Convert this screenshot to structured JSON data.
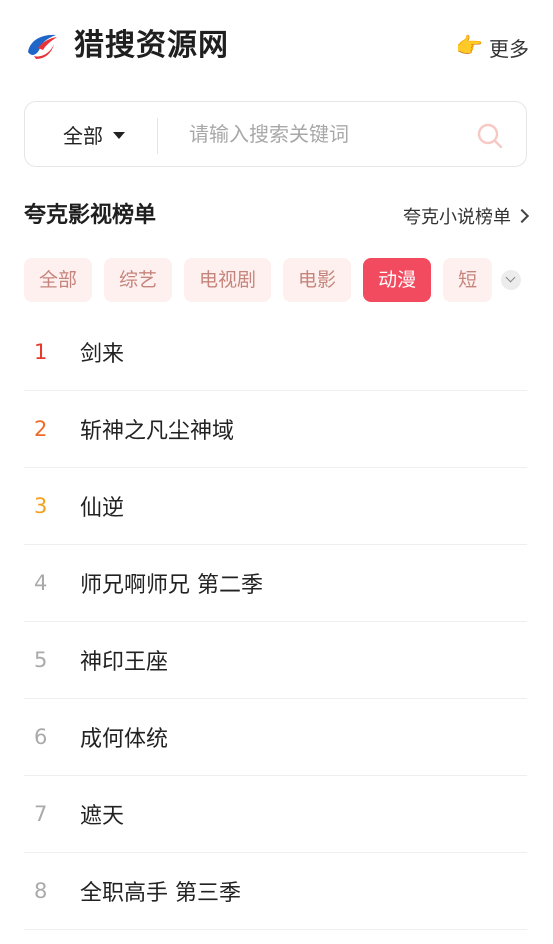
{
  "header": {
    "site_title": "猎搜资源网",
    "more_label": "更多",
    "logo_icon": "bird-logo-icon",
    "more_icon": "pointing-hand-icon"
  },
  "search": {
    "scope_label": "全部",
    "placeholder": "请输入搜索关键词",
    "value": ""
  },
  "section": {
    "title": "夸克影视榜单",
    "novel_link": "夸克小说榜单"
  },
  "tabs": [
    {
      "label": "全部",
      "active": false
    },
    {
      "label": "综艺",
      "active": false
    },
    {
      "label": "电视剧",
      "active": false
    },
    {
      "label": "电影",
      "active": false
    },
    {
      "label": "动漫",
      "active": true
    },
    {
      "label": "短",
      "active": false
    }
  ],
  "ranking": [
    {
      "rank": "1",
      "title": "剑来"
    },
    {
      "rank": "2",
      "title": "斩神之凡尘神域"
    },
    {
      "rank": "3",
      "title": "仙逆"
    },
    {
      "rank": "4",
      "title": "师兄啊师兄 第二季"
    },
    {
      "rank": "5",
      "title": "神印王座"
    },
    {
      "rank": "6",
      "title": "成何体统"
    },
    {
      "rank": "7",
      "title": "遮天"
    },
    {
      "rank": "8",
      "title": "全职高手 第三季"
    }
  ],
  "colors": {
    "accent": "#f24a5f",
    "tab_bg": "#fdf0ee",
    "tab_text": "#c6857c",
    "rank1": "#e83a2b",
    "rank2": "#f06a2a",
    "rank3": "#f2a11e",
    "rank_other": "#aaaaaa"
  }
}
